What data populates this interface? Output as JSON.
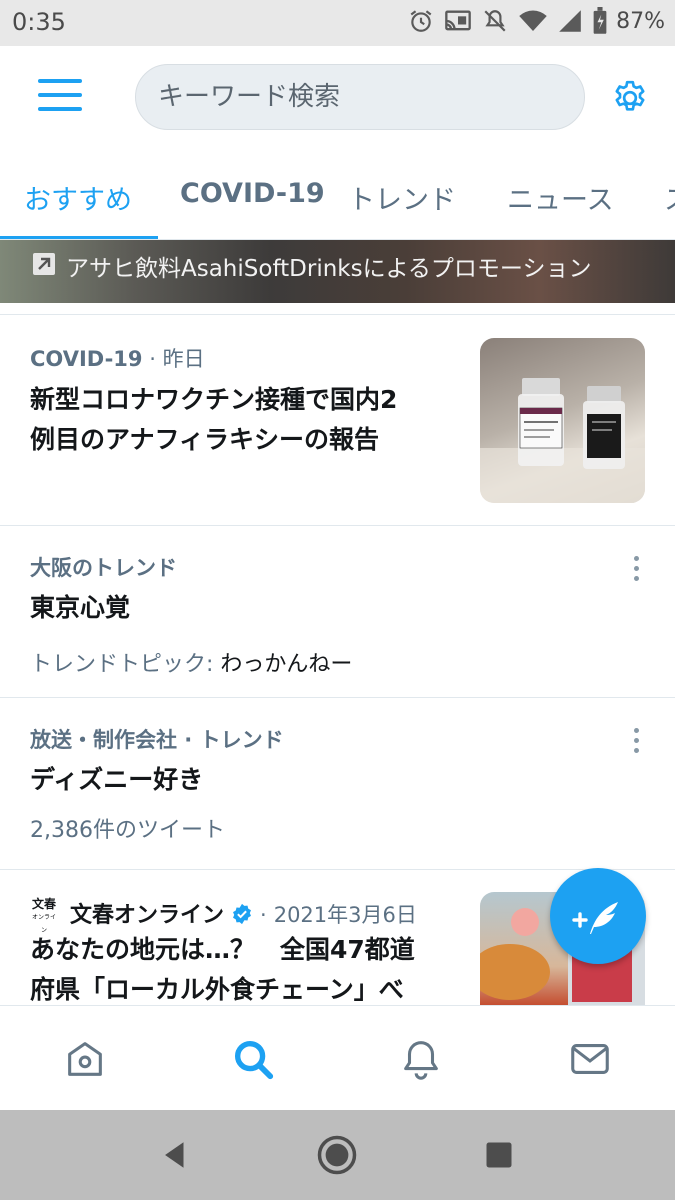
{
  "status_bar": {
    "time": "0:35",
    "battery": "87%",
    "icons": [
      "alarm-icon",
      "cast-icon",
      "mute-icon",
      "wifi-icon",
      "signal-icon",
      "battery-icon"
    ]
  },
  "header": {
    "search_placeholder": "キーワード検索",
    "menu_icon": "hamburger-menu-icon",
    "settings_icon": "gear-icon"
  },
  "tabs": [
    {
      "label": "おすすめ",
      "active": true
    },
    {
      "label": "COVID-19",
      "active": false
    },
    {
      "label": "トレンド",
      "active": false
    },
    {
      "label": "ニュース",
      "active": false
    },
    {
      "label": "ス",
      "active": false
    }
  ],
  "promo": {
    "text": "アサヒ飲料AsahiSoftDrinksによるプロモーション"
  },
  "items": [
    {
      "category": "COVID-19",
      "separator": "·",
      "time": "昨日",
      "headline_line1": "新型コロナワクチン接種で国内2",
      "headline_line2": "例目のアナフィラキシーの報告"
    },
    {
      "context": "大阪のトレンド",
      "title": "東京心覚",
      "sub_label": "トレンドトピック:",
      "sub_value": "わっかんねー"
    },
    {
      "context": "放送・制作会社 · トレンド",
      "title": "ディズニー好き",
      "sub": "2,386件のツイート"
    },
    {
      "source_logo_line1": "文春",
      "source_logo_line2": "オンライン",
      "source": "文春オンライン",
      "separator": "·",
      "date": "2021年3月6日",
      "headline_line1": "あなたの地元は…？　全国47都道",
      "headline_line2": "府県「ローカル外食チェーン」べ"
    }
  ],
  "bottom_nav": [
    "home-icon",
    "search-icon",
    "notifications-icon",
    "messages-icon"
  ],
  "colors": {
    "accent": "#1da1f2",
    "secondary_text": "#5b7083",
    "primary_text": "#14171a"
  }
}
